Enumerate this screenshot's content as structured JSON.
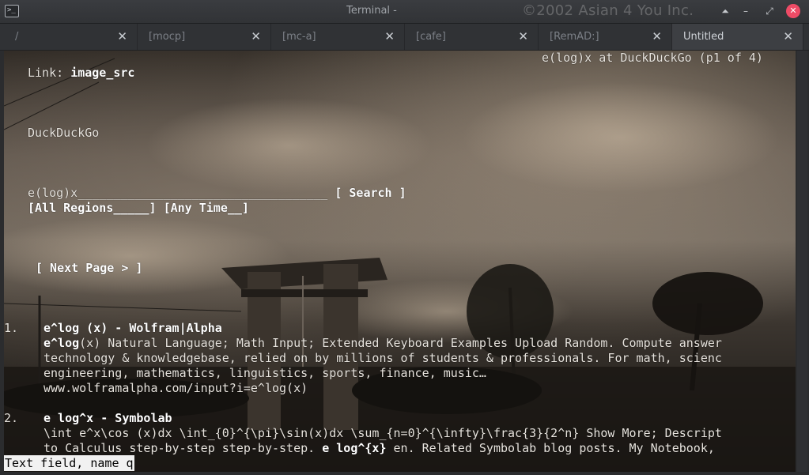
{
  "window": {
    "title": "Terminal - ",
    "watermark": "©2002 Asian 4 You Inc.",
    "buttons": {
      "up": "⏶",
      "minimize": "–",
      "restore": "⤢",
      "close": "✕"
    }
  },
  "tabs": [
    {
      "label": "/",
      "close": "✕"
    },
    {
      "label": "[mocp]",
      "close": "✕"
    },
    {
      "label": "[mc-a]",
      "close": "✕"
    },
    {
      "label": "[cafe]",
      "close": "✕"
    },
    {
      "label": "[RemAD:]",
      "close": "✕"
    },
    {
      "label": "Untitled",
      "close": "✕"
    }
  ],
  "browser": {
    "page_title": "e(log)x at DuckDuckGo (p1 of 4)",
    "link_prefix": "Link: ",
    "link_name": "image_src",
    "site_name": "DuckDuckGo",
    "query": "e(log)x",
    "query_fill": "___________________________________",
    "search_button": "[ Search ]",
    "region_select": "[All Regions_____]",
    "time_select": "[Any Time__]",
    "next_page": "[ Next Page > ]",
    "results": [
      {
        "num": "1.",
        "title": "e^log (x) - Wolfram|Alpha",
        "lines": [
          {
            "bold": "e^log",
            "text": "(x) Natural Language; Math Input; Extended Keyboard Examples Upload Random. Compute answer"
          },
          {
            "bold": "",
            "text": "technology & knowledgebase, relied on by millions of students & professionals. For math, scienc"
          },
          {
            "bold": "",
            "text": "engineering, mathematics, linguistics, sports, finance, music…"
          },
          {
            "bold": "",
            "text": "www.wolframalpha.com/input?i=e^log(x)"
          }
        ]
      },
      {
        "num": "2.",
        "title": "e log^x - Symbolab",
        "lines": [
          {
            "bold": "",
            "text": "\\int e^x\\cos (x)dx \\int_{0}^{\\pi}\\sin(x)dx \\sum_{n=0}^{\\infty}\\frac{3}{2^n} Show More; Descript"
          },
          {
            "pre": "to Calculus step-by-step step-by-step. ",
            "bold": "e log^{x}",
            "text": " en. Related Symbolab blog posts. My Notebook,"
          }
        ]
      }
    ],
    "status": "Text field, name q"
  },
  "colors": {
    "close_button": "#ee4b66",
    "text": "#e8e4de",
    "status_bg": "#f1f1f1"
  },
  "icons": [
    "terminal-icon",
    "close-icon"
  ]
}
